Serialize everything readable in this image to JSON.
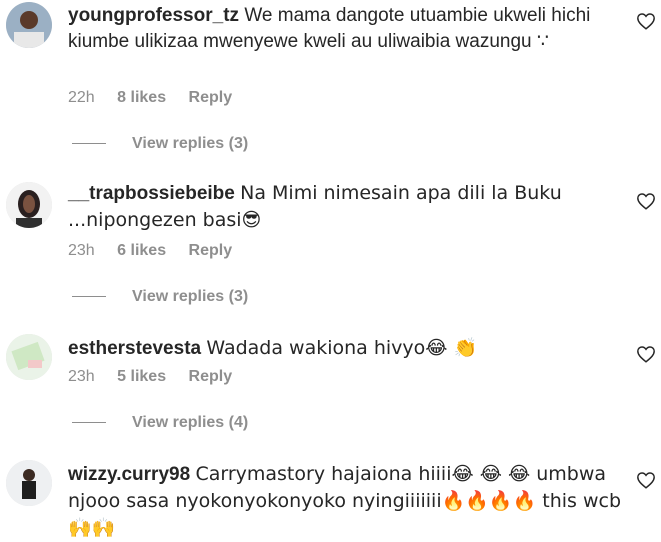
{
  "comments": [
    {
      "username": "youngprofessor_tz",
      "text": "We mama dangote utuambie ukweli hichi kiumbe ulikizaa mwenyewe kweli au uliwaibia wazungu ∵",
      "time": "22h",
      "likes": "8 likes",
      "reply": "Reply",
      "view_replies": "View replies (3)"
    },
    {
      "username": "__trapbossiebeibe",
      "text": "Na Mimi nimesain apa dili la Buku ...nipongezen basi😎",
      "time": "23h",
      "likes": "6 likes",
      "reply": "Reply",
      "view_replies": "View replies (3)"
    },
    {
      "username": "estherstevesta",
      "text": "Wadada wakiona hivyo😂 👏",
      "time": "23h",
      "likes": "5 likes",
      "reply": "Reply",
      "view_replies": "View replies (4)"
    },
    {
      "username": "wizzy.curry98",
      "text": "Carrymastory hajaiona hiiii😂 😂 😂 umbwa njooo sasa nyokonyokonyoko nyingiiiiiii🔥🔥🔥🔥 this wcb 🙌🙌"
    }
  ],
  "icons": {
    "like": "heart-outline-icon"
  }
}
